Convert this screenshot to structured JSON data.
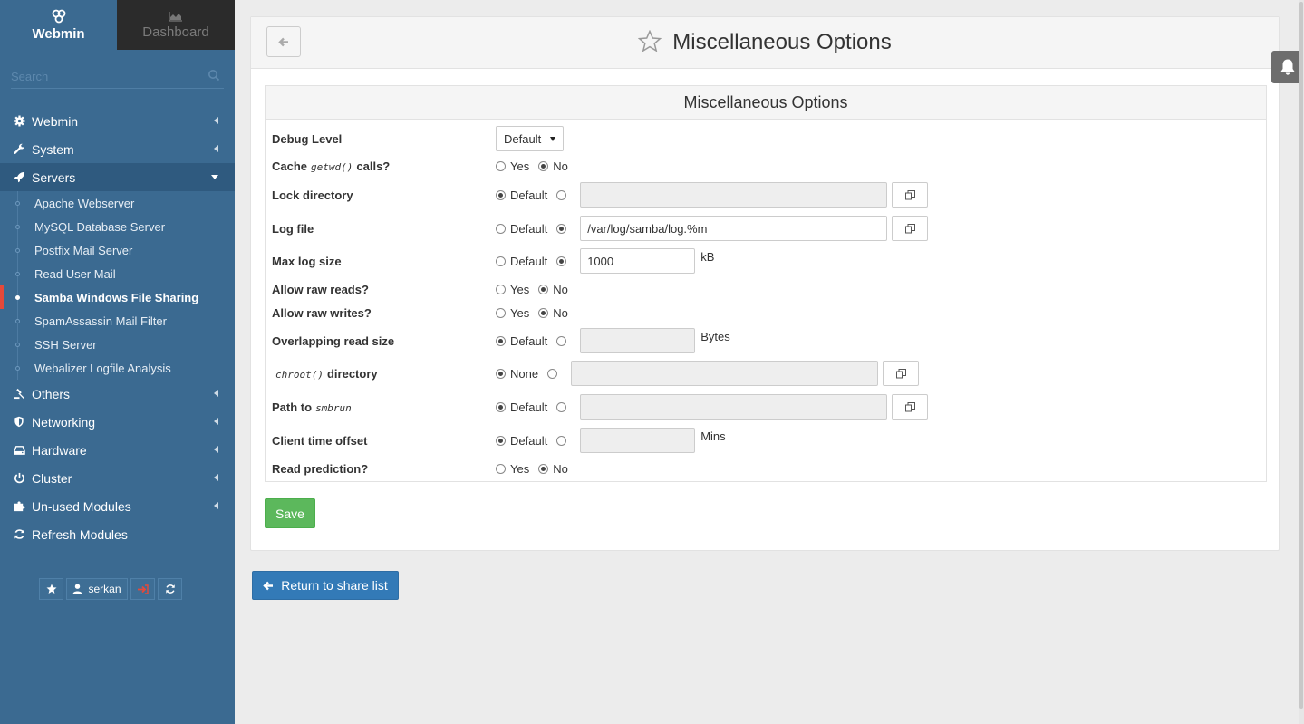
{
  "sidebar": {
    "tabs": {
      "webmin": "Webmin",
      "dashboard": "Dashboard"
    },
    "search_placeholder": "Search",
    "menu": [
      {
        "label": "Webmin",
        "icon": "gear-icon"
      },
      {
        "label": "System",
        "icon": "wrench-icon"
      },
      {
        "label": "Servers",
        "icon": "rocket-icon",
        "active": true
      }
    ],
    "servers_items": [
      "Apache Webserver",
      "MySQL Database Server",
      "Postfix Mail Server",
      "Read User Mail",
      "Samba Windows File Sharing",
      "SpamAssassin Mail Filter",
      "SSH Server",
      "Webalizer Logfile Analysis"
    ],
    "menu_after": [
      {
        "label": "Others",
        "icon": "gavel-icon"
      },
      {
        "label": "Networking",
        "icon": "shield-icon"
      },
      {
        "label": "Hardware",
        "icon": "hdd-icon"
      },
      {
        "label": "Cluster",
        "icon": "power-icon"
      },
      {
        "label": "Un-used Modules",
        "icon": "puzzle-icon"
      },
      {
        "label": "Refresh Modules",
        "icon": "refresh-icon"
      }
    ],
    "username": "serkan"
  },
  "header": {
    "title": "Miscellaneous Options"
  },
  "section": {
    "title": "Miscellaneous Options"
  },
  "form": {
    "debug_level": {
      "label": "Debug Level",
      "value": "Default"
    },
    "cache_getwd": {
      "label_pre": "Cache",
      "code": "getwd()",
      "label_post": "calls?",
      "yes": "Yes",
      "no": "No",
      "selected": "No"
    },
    "lock_directory": {
      "label": "Lock directory",
      "default": "Default",
      "value": "",
      "selected": "Default"
    },
    "log_file": {
      "label": "Log file",
      "default": "Default",
      "value": "/var/log/samba/log.%m",
      "selected": "custom"
    },
    "max_log_size": {
      "label": "Max log size",
      "default": "Default",
      "value": "1000",
      "unit": "kB",
      "selected": "custom"
    },
    "allow_raw_reads": {
      "label": "Allow raw reads?",
      "yes": "Yes",
      "no": "No",
      "selected": "No"
    },
    "allow_raw_writes": {
      "label": "Allow raw writes?",
      "yes": "Yes",
      "no": "No",
      "selected": "No"
    },
    "overlapping_read_size": {
      "label": "Overlapping read size",
      "default": "Default",
      "value": "",
      "unit": "Bytes",
      "selected": "Default"
    },
    "chroot_directory": {
      "code": "chroot()",
      "label_post": "directory",
      "none": "None",
      "value": "",
      "selected": "None"
    },
    "path_to_smbrun": {
      "label_pre": "Path to",
      "code": "smbrun",
      "default": "Default",
      "value": "",
      "selected": "Default"
    },
    "client_time_offset": {
      "label": "Client time offset",
      "default": "Default",
      "value": "",
      "unit": "Mins",
      "selected": "Default"
    },
    "read_prediction": {
      "label": "Read prediction?",
      "yes": "Yes",
      "no": "No",
      "selected": "No"
    }
  },
  "buttons": {
    "save": "Save",
    "return": "Return to share list"
  },
  "colors": {
    "sidebar_bg": "#3b6a91",
    "save_green": "#5cb85c",
    "return_blue": "#337ab7",
    "current_marker": "#e5493a"
  }
}
